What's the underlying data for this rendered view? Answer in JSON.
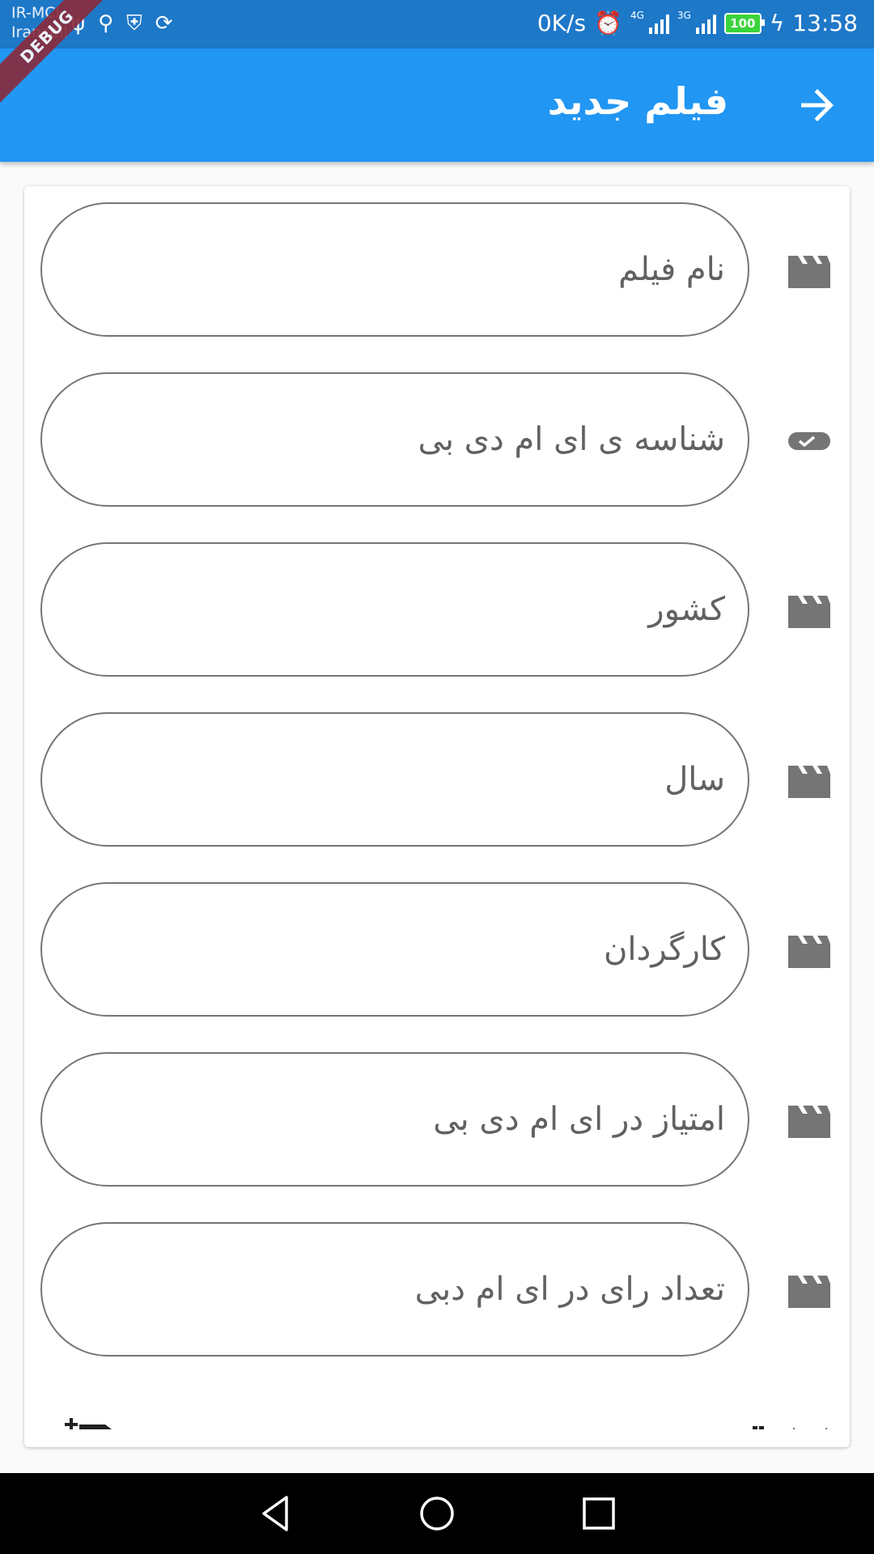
{
  "status_bar": {
    "carrier_line1": "IR-MCI",
    "carrier_line2": "Irancell",
    "net_speed": "0K/s",
    "signal1_label": "4G",
    "signal2_label": "3G",
    "battery": "100",
    "time": "13:58"
  },
  "debug_banner": "DEBUG",
  "app_bar": {
    "title": "فیلم جدید",
    "back_icon": "arrow-forward-icon"
  },
  "form": {
    "fields": [
      {
        "placeholder": "نام فیلم",
        "value": "",
        "icon": "movie-clapper-icon"
      },
      {
        "placeholder": "شناسه ی ای ام دی بی",
        "value": "",
        "icon": "toggle-check-icon"
      },
      {
        "placeholder": "کشور",
        "value": "",
        "icon": "movie-clapper-icon"
      },
      {
        "placeholder": "سال",
        "value": "",
        "icon": "movie-clapper-icon"
      },
      {
        "placeholder": "کارگردان",
        "value": "",
        "icon": "movie-clapper-icon"
      },
      {
        "placeholder": "امتیاز در ای ام دی بی",
        "value": "",
        "icon": "movie-clapper-icon"
      },
      {
        "placeholder": "تعداد رای در ای ام دبی",
        "value": "",
        "icon": "movie-clapper-icon"
      }
    ]
  },
  "nav_bar": {
    "back": "nav-back-icon",
    "home": "nav-home-icon",
    "recents": "nav-recents-icon"
  },
  "colors": {
    "status_bar": "#1e78c8",
    "app_bar": "#2196f3",
    "field_border": "#757575",
    "icon": "#757575"
  }
}
